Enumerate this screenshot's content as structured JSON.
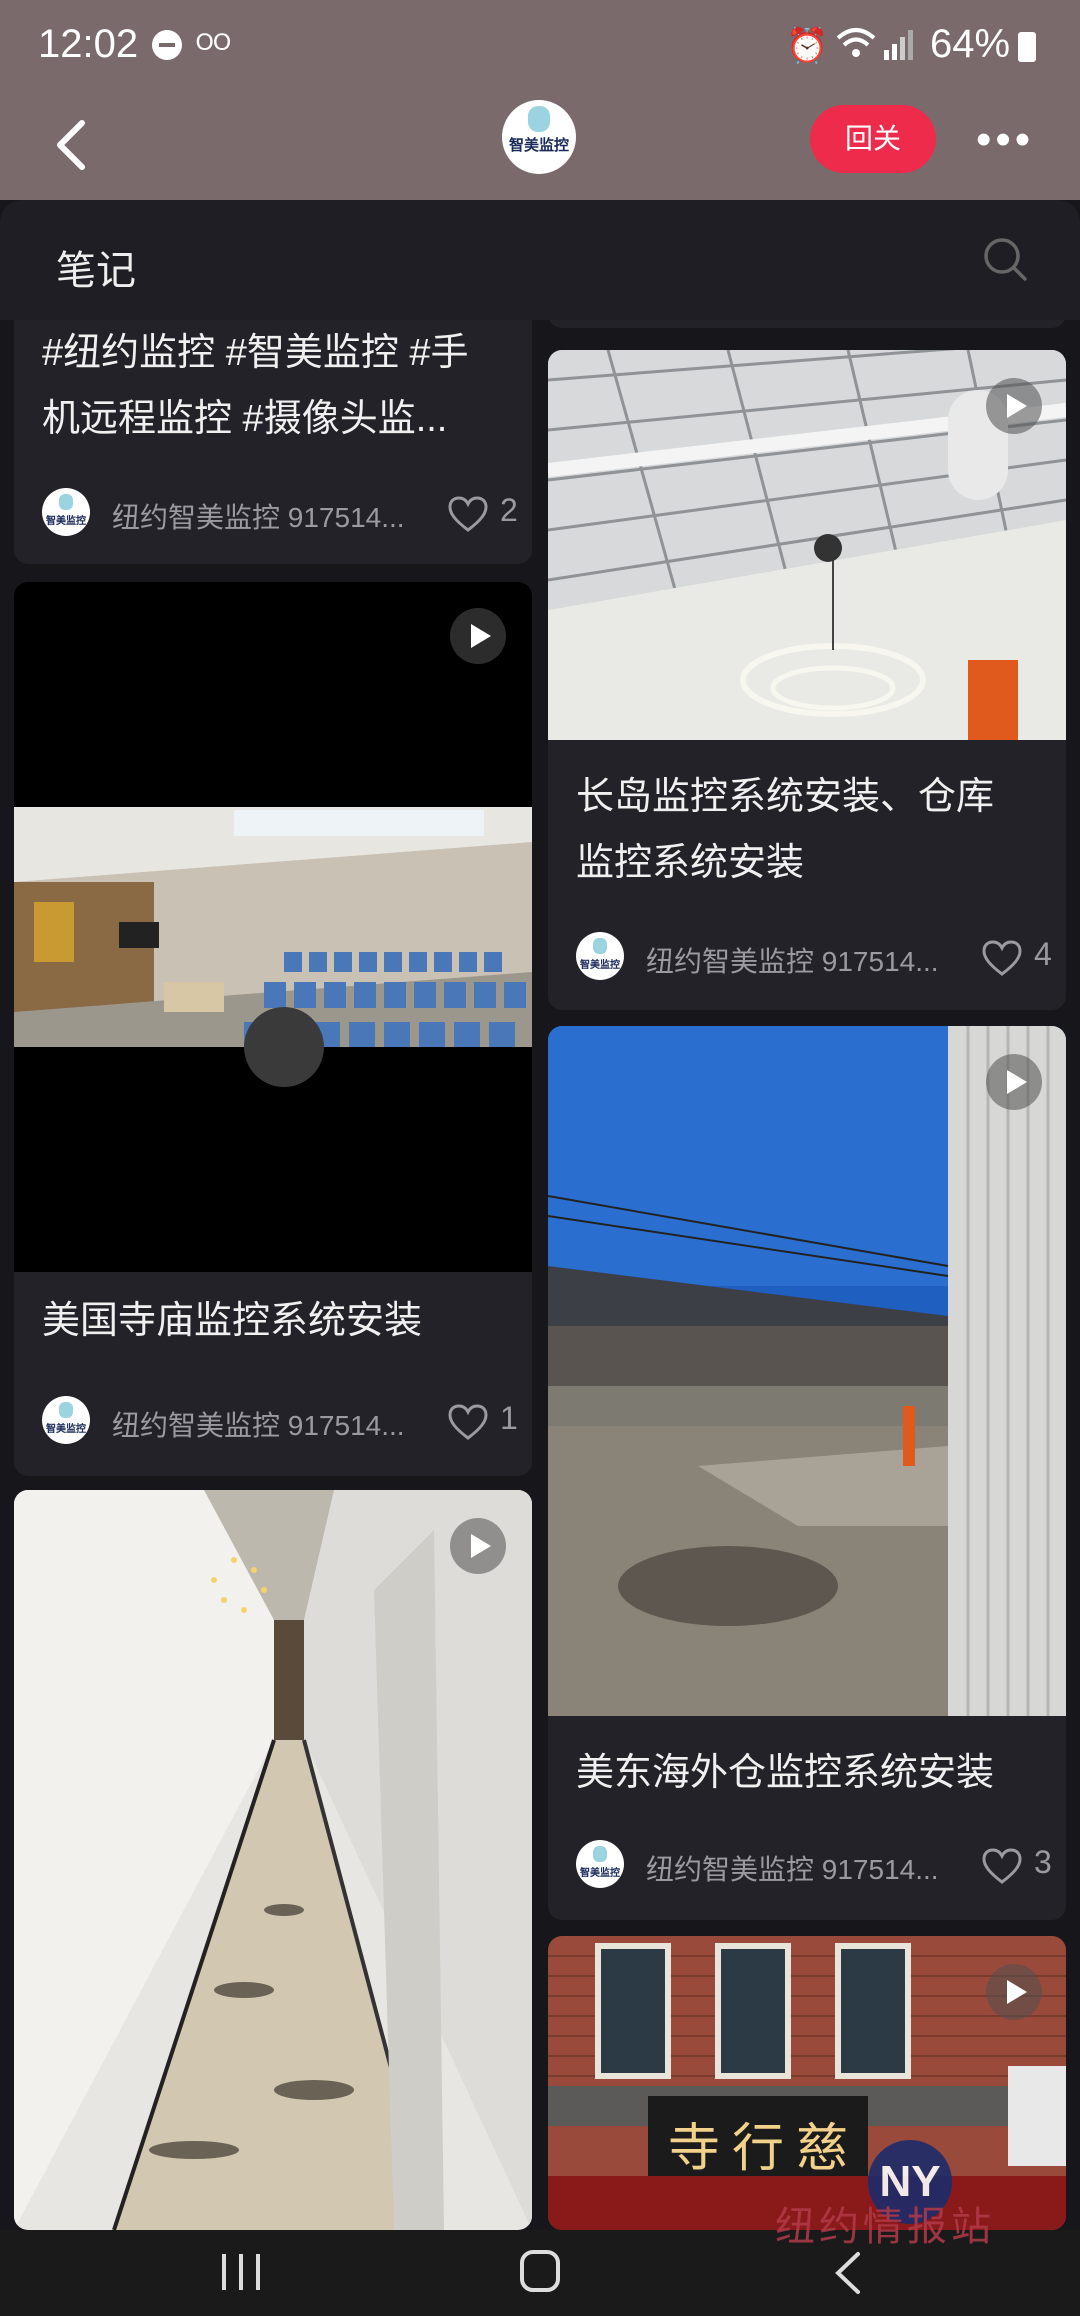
{
  "status_bar": {
    "time": "12:02",
    "battery": "64%"
  },
  "header": {
    "logo_text": "智美监控",
    "follow_label": "回关"
  },
  "sheet": {
    "title": "笔记"
  },
  "cards": [
    {
      "caption_line1": "#纽约监控 #智美监控 #手",
      "caption_line2": "机远程监控 #摄像头监...",
      "author": "纽约智美监控 917514...",
      "likes": "2"
    },
    {
      "caption_line1": "美国寺庙监控系统安装",
      "author": "纽约智美监控 917514...",
      "likes": "1"
    },
    {
      "caption_line1": "长岛监控系统安装、仓库",
      "caption_line2": "监控系统安装",
      "author": "纽约智美监控 917514...",
      "likes": "4"
    },
    {
      "caption_line1": "美东海外仓监控系统安装",
      "author": "纽约智美监控 917514...",
      "likes": "3"
    },
    {
      "sign_text": "寺行慈"
    }
  ],
  "avatar_text": "智美监控",
  "watermark": "纽约情报站",
  "colors": {
    "accent": "#ef2b4b",
    "background": "#16161b",
    "card": "#222228"
  }
}
